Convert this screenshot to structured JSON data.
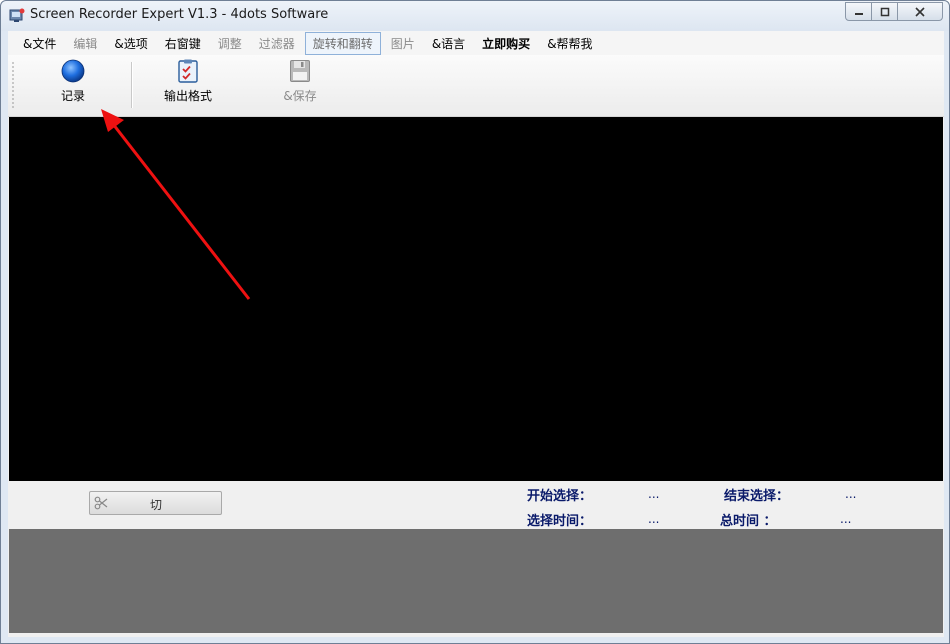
{
  "window": {
    "title": "Screen Recorder Expert V1.3 - 4dots Software"
  },
  "menu": [
    {
      "label": "&文件",
      "disabled": false
    },
    {
      "label": "编辑",
      "disabled": true
    },
    {
      "label": "&选项",
      "disabled": false
    },
    {
      "label": "右窗键",
      "disabled": false
    },
    {
      "label": "调整",
      "disabled": true
    },
    {
      "label": "过滤器",
      "disabled": true
    },
    {
      "label": "旋转和翻转",
      "disabled": true
    },
    {
      "label": "图片",
      "disabled": true
    },
    {
      "label": "&语言",
      "disabled": false
    },
    {
      "label": "立即购买",
      "disabled": false
    },
    {
      "label": "&帮帮我",
      "disabled": false
    }
  ],
  "toolbar": {
    "record_label": "记录",
    "output_format_label": "输出格式",
    "save_label": "&保存"
  },
  "panel": {
    "cut_label": "切",
    "start_selection_label": "开始选择：",
    "start_selection_value": "...",
    "end_selection_label": "结束选择：",
    "end_selection_value": "...",
    "selection_time_label": "选择时间：",
    "selection_time_value": "...",
    "total_time_label": "总时间 ：",
    "total_time_value": "..."
  },
  "icons": {
    "app": "screen-recorder-icon",
    "record": "blue-circle-icon",
    "output_format": "checklist-icon",
    "save": "floppy-disk-icon",
    "cut": "scissors-icon"
  },
  "colors": {
    "video_bg": "#000000",
    "info_text": "#0a1a6a",
    "lower_gray": "#6e6e6e",
    "annotation_arrow": "#ee1111"
  }
}
